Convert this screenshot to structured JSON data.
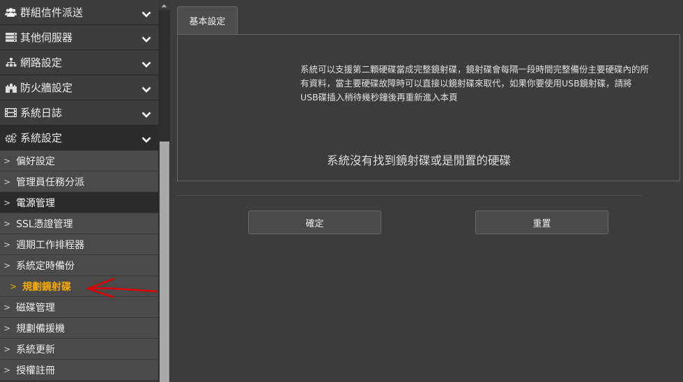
{
  "sidebar": {
    "groups": [
      {
        "label": "群組信件派送",
        "icon": "users-icon"
      },
      {
        "label": "其他伺服器",
        "icon": "server-icon"
      },
      {
        "label": "網路設定",
        "icon": "network-icon"
      },
      {
        "label": "防火牆設定",
        "icon": "firewall-icon"
      },
      {
        "label": "系統日誌",
        "icon": "film-icon"
      },
      {
        "label": "系統設定",
        "icon": "gears-icon"
      }
    ],
    "items": [
      {
        "label": "偏好設定"
      },
      {
        "label": "管理員任務分派"
      },
      {
        "label": "電源管理"
      },
      {
        "label": "SSL憑證管理"
      },
      {
        "label": "週期工作排程器"
      },
      {
        "label": "系統定時備份"
      },
      {
        "label": "規劃鏡射碟"
      },
      {
        "label": "磁碟管理"
      },
      {
        "label": "規劃備援機"
      },
      {
        "label": "系統更新"
      },
      {
        "label": "授權註冊"
      }
    ],
    "arrow": ">"
  },
  "main": {
    "tab_label": "基本設定",
    "description": "系統可以支援第二顆硬碟當成完整鏡射碟，鏡射碟會每隔一段時間完整備份主要硬碟內的所有資料，當主要硬碟故障時可以直接以鏡射碟來取代，如果你要使用USB鏡射碟，請將USB碟插入稍待幾秒鐘後再重新進入本頁",
    "no_disk_message": "系統沒有找到鏡射碟或是閒置的硬碟",
    "confirm_label": "確定",
    "reset_label": "重置"
  },
  "colors": {
    "highlight": "#f2a900",
    "annotation": "#e00000"
  }
}
